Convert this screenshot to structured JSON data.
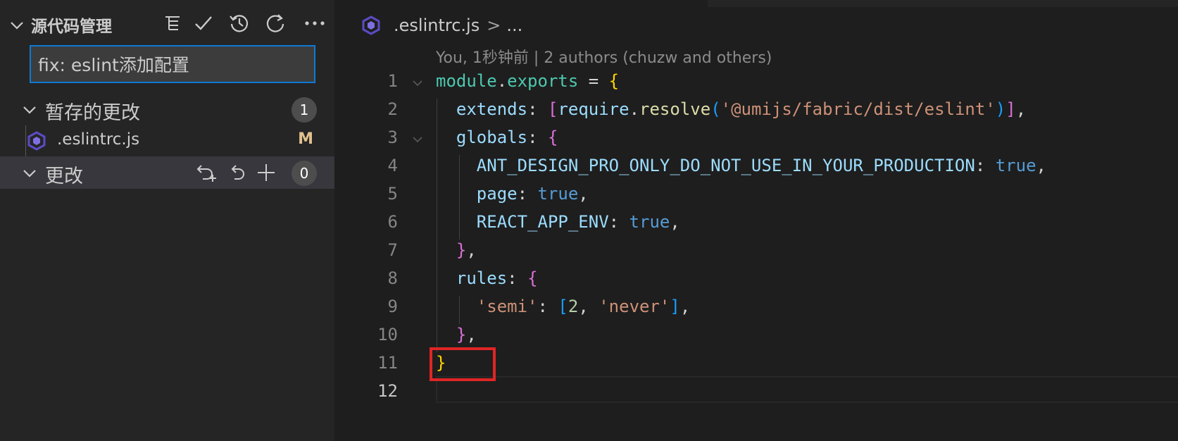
{
  "sidebar": {
    "title": "源代码管理",
    "commit_message": "fix: eslint添加配置",
    "staged": {
      "label": "暂存的更改",
      "count": "1"
    },
    "staged_file": {
      "name": ".eslintrc.js",
      "status": "M"
    },
    "changes": {
      "label": "更改",
      "count": "0"
    }
  },
  "editor": {
    "breadcrumb": {
      "file": ".eslintrc.js",
      "separator": ">",
      "more": "..."
    },
    "blame": "You, 1秒钟前 | 2 authors (chuzw and others)",
    "line_numbers": [
      "1",
      "2",
      "3",
      "4",
      "5",
      "6",
      "7",
      "8",
      "9",
      "10",
      "11",
      "12"
    ],
    "code": {
      "l1": {
        "a": "module",
        "b": ".",
        "c": "exports",
        "d": " = ",
        "e": "{"
      },
      "l2": {
        "a": "extends",
        "b": ": ",
        "c": "[",
        "d": "require",
        "e": ".",
        "f": "resolve",
        "g": "(",
        "h": "'@umijs/fabric/dist/eslint'",
        "i": ")",
        "j": "]",
        "k": ","
      },
      "l3": {
        "a": "globals",
        "b": ": ",
        "c": "{"
      },
      "l4": {
        "a": "ANT_DESIGN_PRO_ONLY_DO_NOT_USE_IN_YOUR_PRODUCTION",
        "b": ": ",
        "c": "true",
        "d": ","
      },
      "l5": {
        "a": "page",
        "b": ": ",
        "c": "true",
        "d": ","
      },
      "l6": {
        "a": "REACT_APP_ENV",
        "b": ": ",
        "c": "true",
        "d": ","
      },
      "l7": {
        "a": "}",
        "b": ","
      },
      "l8": {
        "a": "rules",
        "b": ": ",
        "c": "{"
      },
      "l9": {
        "a": "'semi'",
        "b": ": ",
        "c": "[",
        "d": "2",
        "e": ", ",
        "f": "'never'",
        "g": "]",
        "h": ","
      },
      "l10": {
        "a": "}",
        "b": ","
      },
      "l11": {
        "a": "}"
      }
    }
  },
  "colors": {
    "accent": "#0e7ad6",
    "highlight": "#e02525",
    "modified": "#e2c08d",
    "eslint_icon": "#5b4cc4"
  },
  "icons": [
    "chevron-down-icon",
    "tree-view-icon",
    "commit-check-icon",
    "history-icon",
    "refresh-icon",
    "more-icon",
    "discard-all-icon",
    "undo-icon",
    "plus-icon",
    "eslint-file-icon"
  ]
}
